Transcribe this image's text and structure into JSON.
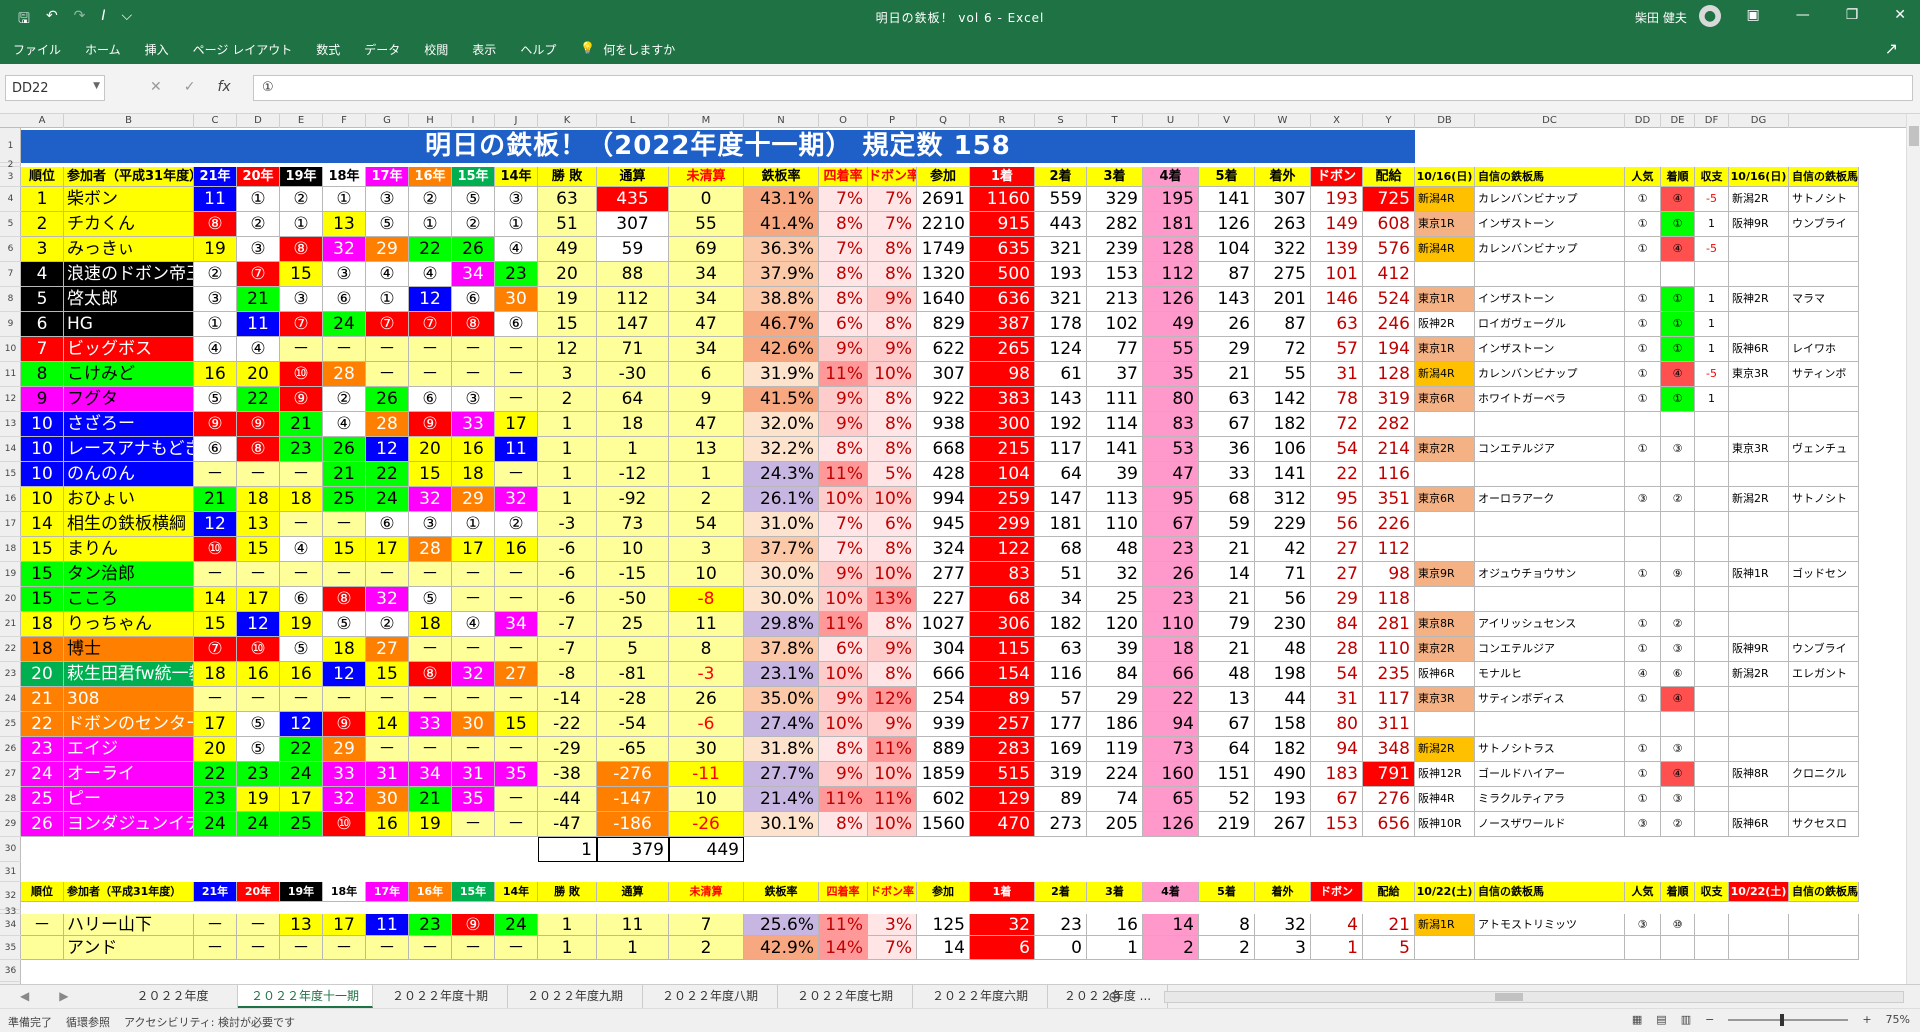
{
  "titlebar": {
    "title": "明日の鉄板！ vol 6 - Excel",
    "user": "柴田 健夫"
  },
  "ribbon_menu": [
    "ファイル",
    "ホーム",
    "挿入",
    "ページ レイアウト",
    "数式",
    "データ",
    "校閲",
    "表示",
    "ヘルプ"
  ],
  "tellme": "何をしますか",
  "namebox": "DD22",
  "formula": "①",
  "columns": [
    "A",
    "B",
    "C",
    "D",
    "E",
    "F",
    "G",
    "H",
    "I",
    "J",
    "K",
    "L",
    "M",
    "N",
    "O",
    "P",
    "Q",
    "R",
    "S",
    "T",
    "U",
    "V",
    "W",
    "X",
    "Y",
    "DB",
    "DC",
    "DD",
    "DE",
    "DF",
    "DG"
  ],
  "row_numbers": [
    "1",
    "2",
    "3",
    "4",
    "5",
    "6",
    "7",
    "8",
    "9",
    "10",
    "11",
    "12",
    "13",
    "14",
    "15",
    "16",
    "17",
    "18",
    "19",
    "20",
    "21",
    "22",
    "23",
    "24",
    "25",
    "26",
    "27",
    "28",
    "29",
    "30",
    "31",
    "32",
    "33",
    "34",
    "35",
    "36"
  ],
  "banner": "明日の鉄板！（2022年度十一期） 規定数 158",
  "headers": [
    "順位",
    "参加者（平成31年度）",
    "21年",
    "20年",
    "19年",
    "18年",
    "17年",
    "16年",
    "15年",
    "14年",
    "勝 敗",
    "通算",
    "未清算",
    "鉄板率",
    "四着率",
    "ドボン率",
    "参加",
    "1着",
    "2着",
    "3着",
    "4着",
    "5着",
    "着外",
    "ドボン",
    "配給"
  ],
  "right_headers": [
    "10/16(日)",
    "自信の鉄板馬",
    "人気",
    "着順",
    "収支",
    "10/16(日)",
    "自信の鉄板馬"
  ],
  "rows": [
    [
      "1",
      "柴ボン",
      "11",
      "①",
      "②",
      "①",
      "③",
      "②",
      "⑤",
      "③",
      "63",
      "435",
      "0",
      "43.1%",
      "7%",
      "7%",
      "2691",
      "1160",
      "559",
      "329",
      "195",
      "141",
      "307",
      "193",
      "725",
      "新潟4R",
      "カレンバンビナップ",
      "①",
      "④",
      "-5",
      "新潟2R",
      "サトノシト"
    ],
    [
      "2",
      "チカくん",
      "⑧",
      "②",
      "①",
      "13",
      "⑤",
      "①",
      "②",
      "①",
      "51",
      "307",
      "55",
      "41.4%",
      "8%",
      "7%",
      "2210",
      "915",
      "443",
      "282",
      "181",
      "126",
      "263",
      "149",
      "608",
      "東京1R",
      "インザストーン",
      "①",
      "①",
      "1",
      "阪神9R",
      "ウンブライ"
    ],
    [
      "3",
      "みっきぃ",
      "19",
      "③",
      "⑧",
      "32",
      "29",
      "22",
      "26",
      "④",
      "49",
      "59",
      "69",
      "36.3%",
      "7%",
      "8%",
      "1749",
      "635",
      "321",
      "239",
      "128",
      "104",
      "322",
      "139",
      "576",
      "新潟4R",
      "カレンバンビナップ",
      "①",
      "④",
      "-5",
      "",
      ""
    ],
    [
      "4",
      "浪速のドボン帝王",
      "②",
      "⑦",
      "15",
      "③",
      "④",
      "④",
      "34",
      "23",
      "20",
      "88",
      "34",
      "37.9%",
      "8%",
      "8%",
      "1320",
      "500",
      "193",
      "153",
      "112",
      "87",
      "275",
      "101",
      "412",
      "",
      "",
      "",
      "",
      "",
      "",
      ""
    ],
    [
      "5",
      "啓太郎",
      "③",
      "21",
      "③",
      "⑥",
      "①",
      "12",
      "⑥",
      "30",
      "19",
      "112",
      "34",
      "38.8%",
      "8%",
      "9%",
      "1640",
      "636",
      "321",
      "213",
      "126",
      "143",
      "201",
      "146",
      "524",
      "東京1R",
      "インザストーン",
      "①",
      "①",
      "1",
      "阪神2R",
      "マラマ"
    ],
    [
      "6",
      "HG",
      "①",
      "11",
      "⑦",
      "24",
      "⑦",
      "⑦",
      "⑧",
      "⑥",
      "15",
      "147",
      "47",
      "46.7%",
      "6%",
      "8%",
      "829",
      "387",
      "178",
      "102",
      "49",
      "26",
      "87",
      "63",
      "246",
      "阪神2R",
      "ロイガヴェーグル",
      "①",
      "①",
      "1",
      "",
      ""
    ],
    [
      "7",
      "ビッグボス",
      "④",
      "④",
      "－",
      "－",
      "－",
      "－",
      "－",
      "－",
      "12",
      "71",
      "34",
      "42.6%",
      "9%",
      "9%",
      "622",
      "265",
      "124",
      "77",
      "55",
      "29",
      "72",
      "57",
      "194",
      "東京1R",
      "インザストーン",
      "①",
      "①",
      "1",
      "阪神6R",
      "レイワホ"
    ],
    [
      "8",
      "こけみど",
      "16",
      "20",
      "⑩",
      "28",
      "－",
      "－",
      "－",
      "－",
      "3",
      "-30",
      "6",
      "31.9%",
      "11%",
      "10%",
      "307",
      "98",
      "61",
      "37",
      "35",
      "21",
      "55",
      "31",
      "128",
      "新潟4R",
      "カレンバンビナップ",
      "①",
      "④",
      "-5",
      "東京3R",
      "サティンボ"
    ],
    [
      "9",
      "フグタ",
      "⑤",
      "22",
      "⑨",
      "②",
      "26",
      "⑥",
      "③",
      "－",
      "2",
      "64",
      "9",
      "41.5%",
      "9%",
      "8%",
      "922",
      "383",
      "143",
      "111",
      "80",
      "63",
      "142",
      "78",
      "319",
      "東京6R",
      "ホワイトガーベラ",
      "①",
      "①",
      "1",
      "",
      ""
    ],
    [
      "10",
      "さざろー",
      "⑨",
      "⑨",
      "21",
      "④",
      "28",
      "⑨",
      "33",
      "17",
      "1",
      "18",
      "47",
      "32.0%",
      "9%",
      "8%",
      "938",
      "300",
      "192",
      "114",
      "83",
      "67",
      "182",
      "72",
      "282",
      "",
      "",
      "",
      "",
      "",
      "",
      ""
    ],
    [
      "10",
      "レースアナもどき",
      "⑥",
      "⑧",
      "23",
      "26",
      "12",
      "20",
      "16",
      "11",
      "1",
      "1",
      "13",
      "32.2%",
      "8%",
      "8%",
      "668",
      "215",
      "117",
      "141",
      "53",
      "36",
      "106",
      "54",
      "214",
      "東京2R",
      "コンエテルジア",
      "①",
      "③",
      "",
      "東京3R",
      "ヴェンチュ"
    ],
    [
      "10",
      "のんのん",
      "－",
      "－",
      "－",
      "21",
      "22",
      "15",
      "18",
      "－",
      "1",
      "-12",
      "1",
      "24.3%",
      "11%",
      "5%",
      "428",
      "104",
      "64",
      "39",
      "47",
      "33",
      "141",
      "22",
      "116",
      "",
      "",
      "",
      "",
      "",
      "",
      ""
    ],
    [
      "10",
      "おひょい",
      "21",
      "18",
      "18",
      "25",
      "24",
      "32",
      "29",
      "32",
      "1",
      "-92",
      "2",
      "26.1%",
      "10%",
      "10%",
      "994",
      "259",
      "147",
      "113",
      "95",
      "68",
      "312",
      "95",
      "351",
      "東京6R",
      "オーロラアーク",
      "③",
      "②",
      "",
      "新潟2R",
      "サトノシト"
    ],
    [
      "14",
      "相生の鉄板横綱",
      "12",
      "13",
      "－",
      "－",
      "⑥",
      "③",
      "①",
      "②",
      "-3",
      "73",
      "54",
      "31.0%",
      "7%",
      "6%",
      "945",
      "299",
      "181",
      "110",
      "67",
      "59",
      "229",
      "56",
      "226",
      "",
      "",
      "",
      "",
      "",
      "",
      ""
    ],
    [
      "15",
      "まりん",
      "⑩",
      "15",
      "④",
      "15",
      "17",
      "28",
      "17",
      "16",
      "-6",
      "10",
      "3",
      "37.7%",
      "7%",
      "8%",
      "324",
      "122",
      "68",
      "48",
      "23",
      "21",
      "42",
      "27",
      "112",
      "",
      "",
      "",
      "",
      "",
      "",
      ""
    ],
    [
      "15",
      "タン治郎",
      "－",
      "－",
      "－",
      "－",
      "－",
      "－",
      "－",
      "－",
      "-6",
      "-15",
      "10",
      "30.0%",
      "9%",
      "10%",
      "277",
      "83",
      "51",
      "32",
      "26",
      "14",
      "71",
      "27",
      "98",
      "東京9R",
      "オジュウチョウサン",
      "①",
      "⑨",
      "",
      "阪神1R",
      "ゴッドセン"
    ],
    [
      "15",
      "こころ",
      "14",
      "17",
      "⑥",
      "⑧",
      "32",
      "⑤",
      "－",
      "－",
      "-6",
      "-50",
      "-8",
      "30.0%",
      "10%",
      "13%",
      "227",
      "68",
      "34",
      "25",
      "23",
      "21",
      "56",
      "29",
      "118",
      "",
      "",
      "",
      "",
      "",
      "",
      ""
    ],
    [
      "18",
      "りっちゃん",
      "15",
      "12",
      "19",
      "⑤",
      "②",
      "18",
      "④",
      "34",
      "-7",
      "25",
      "11",
      "29.8%",
      "11%",
      "8%",
      "1027",
      "306",
      "182",
      "120",
      "110",
      "79",
      "230",
      "84",
      "281",
      "東京8R",
      "アイリッシュセンス",
      "①",
      "②",
      "",
      "",
      ""
    ],
    [
      "18",
      "博士",
      "⑦",
      "⑩",
      "⑤",
      "18",
      "27",
      "－",
      "－",
      "－",
      "-7",
      "5",
      "8",
      "37.8%",
      "6%",
      "9%",
      "304",
      "115",
      "63",
      "39",
      "18",
      "21",
      "48",
      "28",
      "110",
      "東京2R",
      "コンエテルジア",
      "①",
      "③",
      "",
      "阪神9R",
      "ウンブライ"
    ],
    [
      "20",
      "萩生田君fw統一教会",
      "18",
      "16",
      "16",
      "12",
      "15",
      "⑧",
      "32",
      "27",
      "-8",
      "-81",
      "-3",
      "23.1%",
      "10%",
      "8%",
      "666",
      "154",
      "116",
      "84",
      "66",
      "48",
      "198",
      "54",
      "235",
      "阪神6R",
      "モナルヒ",
      "④",
      "⑥",
      "",
      "新潟2R",
      "エレガント"
    ],
    [
      "21",
      "308",
      "－",
      "－",
      "－",
      "－",
      "－",
      "－",
      "－",
      "－",
      "-14",
      "-28",
      "26",
      "35.0%",
      "9%",
      "12%",
      "254",
      "89",
      "57",
      "29",
      "22",
      "13",
      "44",
      "31",
      "117",
      "東京3R",
      "サティンボディス",
      "①",
      "④",
      "",
      "",
      ""
    ],
    [
      "22",
      "ドボンのセンター",
      "17",
      "⑤",
      "12",
      "⑨",
      "14",
      "33",
      "30",
      "15",
      "-22",
      "-54",
      "-6",
      "27.4%",
      "10%",
      "9%",
      "939",
      "257",
      "177",
      "186",
      "94",
      "67",
      "158",
      "80",
      "311",
      "",
      "",
      "",
      "",
      "",
      "",
      ""
    ],
    [
      "23",
      "エイジ",
      "20",
      "⑤",
      "22",
      "29",
      "－",
      "－",
      "－",
      "－",
      "-29",
      "-65",
      "30",
      "31.8%",
      "8%",
      "11%",
      "889",
      "283",
      "169",
      "119",
      "73",
      "64",
      "182",
      "94",
      "348",
      "新潟2R",
      "サトノシトラス",
      "①",
      "③",
      "",
      "",
      ""
    ],
    [
      "24",
      "オーライ",
      "22",
      "23",
      "24",
      "33",
      "31",
      "34",
      "31",
      "35",
      "-38",
      "-276",
      "-11",
      "27.7%",
      "9%",
      "10%",
      "1859",
      "515",
      "319",
      "224",
      "160",
      "151",
      "490",
      "183",
      "791",
      "阪神12R",
      "ゴールドハイアー",
      "①",
      "④",
      "",
      "阪神8R",
      "クロニクル"
    ],
    [
      "25",
      "ピー",
      "23",
      "19",
      "17",
      "32",
      "30",
      "21",
      "35",
      "－",
      "-44",
      "-147",
      "10",
      "21.4%",
      "11%",
      "11%",
      "602",
      "129",
      "89",
      "74",
      "65",
      "52",
      "193",
      "67",
      "276",
      "阪神4R",
      "ミラクルティアラ",
      "①",
      "③",
      "",
      "",
      ""
    ],
    [
      "26",
      "ヨンダジュンイチ",
      "24",
      "24",
      "25",
      "⑩",
      "16",
      "19",
      "－",
      "－",
      "-47",
      "-186",
      "-26",
      "30.1%",
      "8%",
      "10%",
      "1560",
      "470",
      "273",
      "205",
      "126",
      "219",
      "267",
      "153",
      "656",
      "阪神10R",
      "ノースザワールド",
      "③",
      "②",
      "",
      "阪神6R",
      "サクセスロ"
    ]
  ],
  "totals": [
    "1",
    "379",
    "449"
  ],
  "headers2": [
    "順位",
    "参加者（平成31年度）",
    "21年",
    "20年",
    "19年",
    "18年",
    "17年",
    "16年",
    "15年",
    "14年",
    "勝 敗",
    "通算",
    "未清算",
    "鉄板率",
    "四着率",
    "ドボン率",
    "参加",
    "1着",
    "2着",
    "3着",
    "4着",
    "5着",
    "着外",
    "ドボン",
    "配給",
    "10/22(土)",
    "自信の鉄板馬",
    "人気",
    "着順",
    "収支",
    "10/22(土)",
    "自信の鉄板馬"
  ],
  "rows2": [
    [
      "－",
      "ハリー山下",
      "－",
      "－",
      "13",
      "17",
      "11",
      "23",
      "⑨",
      "24",
      "1",
      "11",
      "7",
      "25.6%",
      "11%",
      "3%",
      "125",
      "32",
      "23",
      "16",
      "14",
      "8",
      "32",
      "4",
      "21",
      "新潟1R",
      "アトモストリミッツ",
      "③",
      "⑩",
      "",
      "",
      ""
    ],
    [
      "",
      "アンド",
      "－",
      "－",
      "－",
      "－",
      "－",
      "－",
      "－",
      "－",
      "1",
      "1",
      "2",
      "42.9%",
      "14%",
      "7%",
      "14",
      "6",
      "0",
      "1",
      "2",
      "2",
      "3",
      "1",
      "5",
      "",
      "",
      "",
      "",
      "",
      "",
      ""
    ]
  ],
  "tabs": [
    "２０２２年度",
    "２０２２年度十一期",
    "２０２２年度十期",
    "２０２２年度九期",
    "２０２２年度八期",
    "２０２２年度七期",
    "２０２２年度六期",
    "２０２２年度 ..."
  ],
  "active_tab": 1,
  "status": {
    "ready": "準備完了",
    "circular": "循環参照",
    "accessibility": "アクセシビリティ: 検討が必要です",
    "zoom": "75%"
  },
  "colors": {
    "excel_green": "#1f7244",
    "banner_blue": "#1f5fc8",
    "name_yellow": "#ffff00",
    "header_yellow": "#ffff00",
    "red": "#ff0000"
  }
}
